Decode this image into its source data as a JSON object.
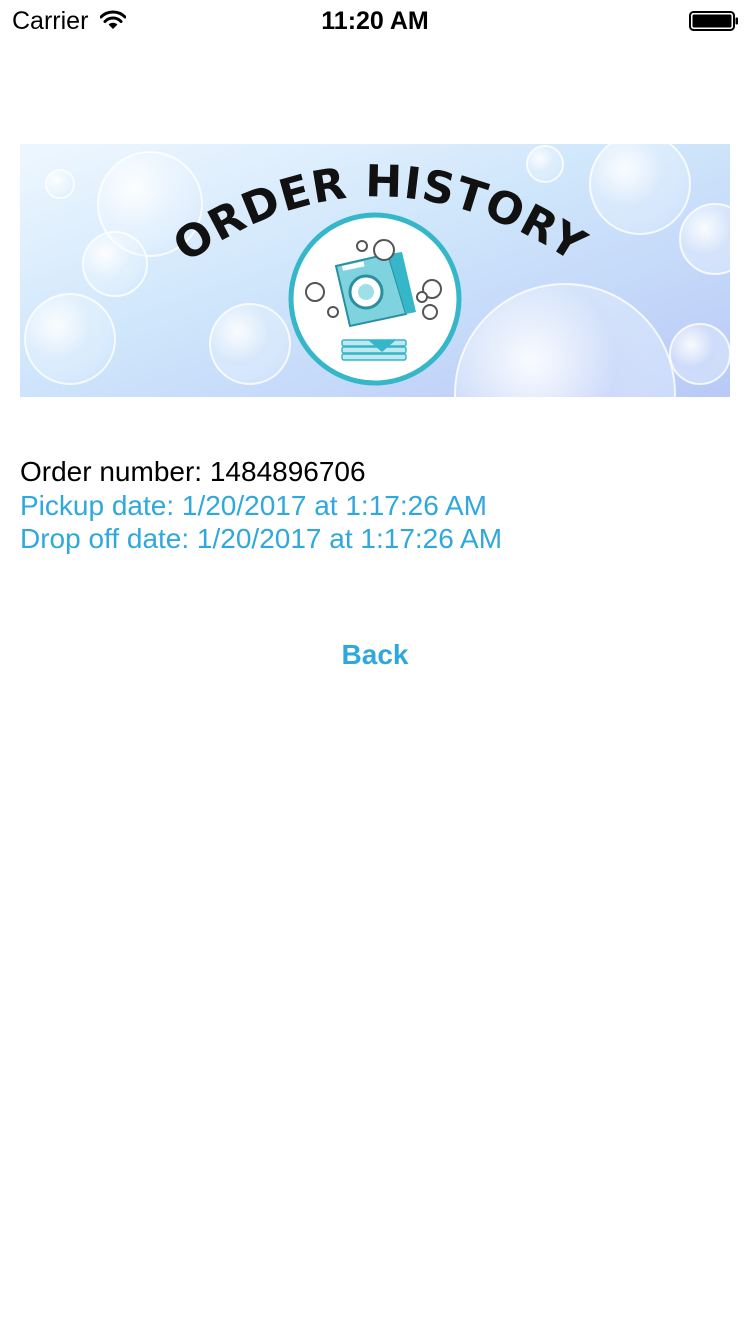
{
  "status_bar": {
    "carrier": "Carrier",
    "time": "11:20 AM",
    "wifi_icon": "wifi-icon",
    "battery_icon": "battery-icon"
  },
  "banner": {
    "title": "ORDER HISTORY",
    "logo_icon": "washing-machine-icon"
  },
  "order": {
    "order_number": "Order number: 1484896706",
    "pickup_date": "Pickup date: 1/20/2017 at 1:17:26 AM",
    "dropoff_date": "Drop off date: 1/20/2017 at 1:17:26 AM"
  },
  "actions": {
    "back_label": "Back"
  },
  "colors": {
    "accent": "#2fa8dd",
    "logo_teal": "#35b6c9",
    "text": "#000000",
    "background": "#ffffff"
  }
}
